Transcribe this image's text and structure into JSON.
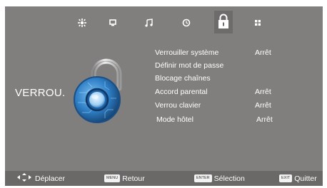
{
  "tabs": [
    {
      "icon": "picture-icon",
      "active": false
    },
    {
      "icon": "screen-icon",
      "active": false
    },
    {
      "icon": "music-note-icon",
      "active": false
    },
    {
      "icon": "clock-icon",
      "active": false
    },
    {
      "icon": "padlock-icon",
      "active": true
    },
    {
      "icon": "grid-icon",
      "active": false
    }
  ],
  "section_label": "VERROU.",
  "menu": [
    {
      "label": "Verrouiller système",
      "value": "Arrêt"
    },
    {
      "label": "Définir mot de passe",
      "value": ""
    },
    {
      "label": "Blocage chaînes",
      "value": ""
    },
    {
      "label": "Accord parental",
      "value": "Arrêt"
    },
    {
      "label": "Verrou clavier",
      "value": "Arrêt"
    },
    {
      "label": "Mode hôtel",
      "value": "Arrêt"
    }
  ],
  "footer": {
    "move_label": "Déplacer",
    "menu_key": "MENU",
    "back_label": "Retour",
    "enter_key": "ENTER",
    "select_label": "Sélection",
    "exit_key": "EXIT",
    "exit_label": "Quitter"
  },
  "colors": {
    "background": "#807f7d",
    "footer": "#6a6968",
    "text": "#ffffff",
    "lock_blue": "#2f7fc6"
  }
}
